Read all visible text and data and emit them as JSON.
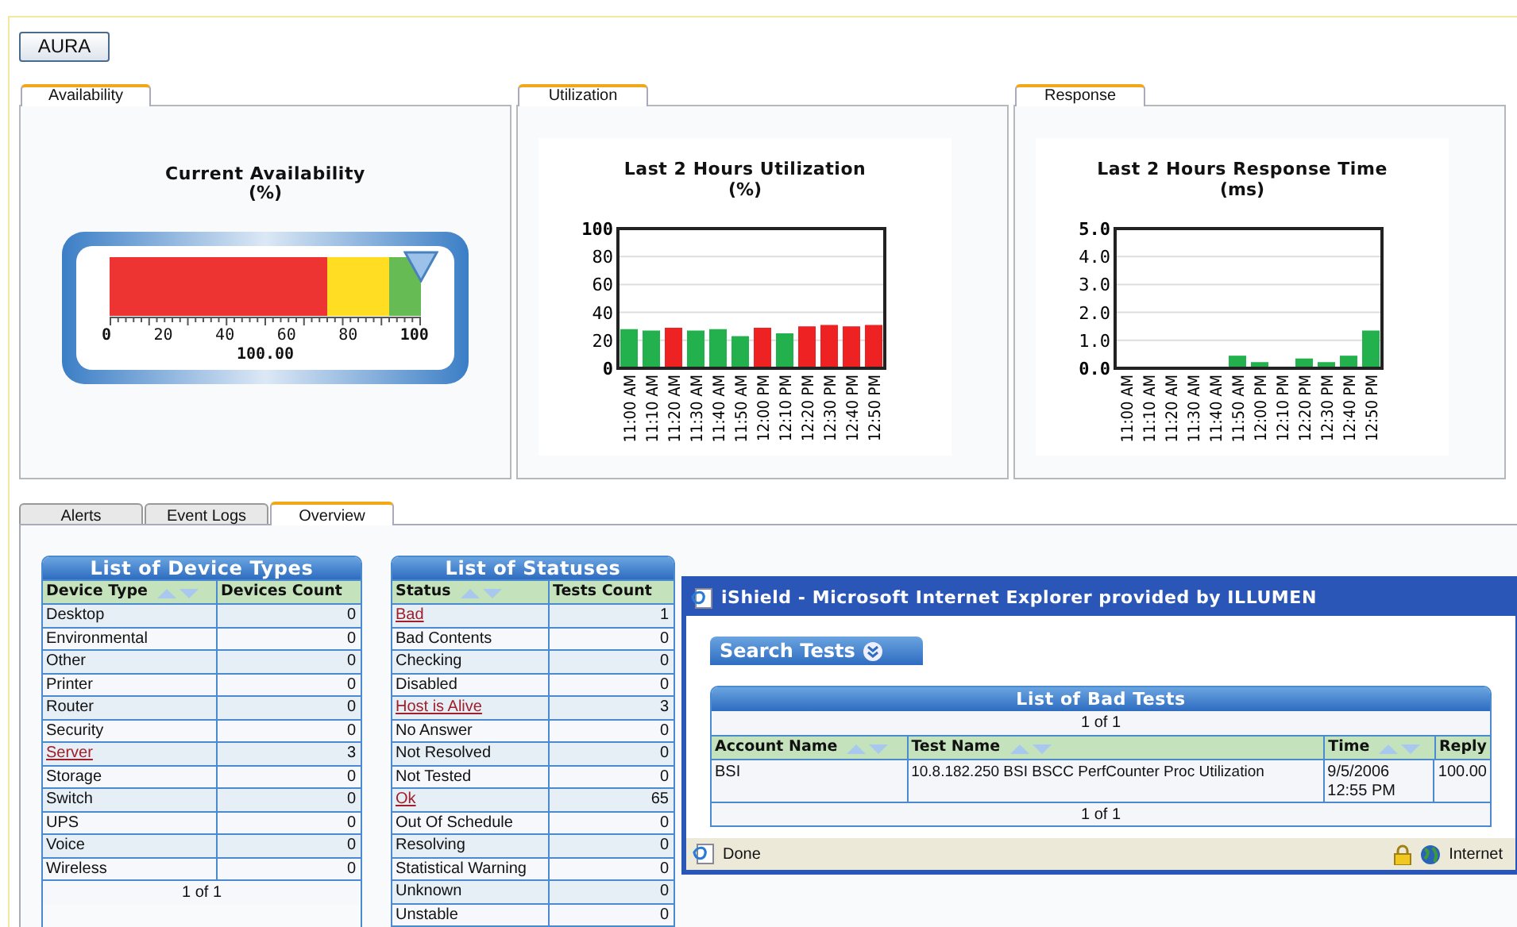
{
  "account_button": "AURA",
  "panels": [
    {
      "tab": "Availability",
      "kind": "gauge",
      "title": "Current Availability",
      "unit": "(%)",
      "reading": "100.00",
      "scale": [
        "0",
        "20",
        "40",
        "60",
        "80",
        "100"
      ],
      "bands": [
        {
          "color": "#ee3333"
        },
        {
          "color": "#ffdd22"
        },
        {
          "color": "#66bb55"
        }
      ]
    },
    {
      "tab": "Utilization",
      "kind": "chart",
      "chart_data": {
        "type": "bar",
        "title": "Last 2 Hours Utilization",
        "ylabel": "(%)",
        "stacked": true,
        "categories": [
          "11:00 AM",
          "11:10 AM",
          "11:20 AM",
          "11:30 AM",
          "11:40 AM",
          "11:50 AM",
          "12:00 PM",
          "12:10 PM",
          "12:20 PM",
          "12:30 PM",
          "12:40 PM",
          "12:50 PM"
        ],
        "series": [
          {
            "color": "#22b14c",
            "values": [
              28,
              27,
              null,
              27,
              28,
              23,
              null,
              25,
              null,
              null,
              null,
              null
            ]
          },
          {
            "color": "#ee2222",
            "values": [
              null,
              null,
              29,
              null,
              null,
              null,
              29,
              null,
              30,
              31,
              30,
              31
            ]
          }
        ],
        "ylim": [
          0,
          100
        ],
        "yticks": [
          0,
          20,
          40,
          60,
          80,
          100
        ],
        "grid": true
      }
    },
    {
      "tab": "Response",
      "kind": "chart",
      "chart_data": {
        "type": "bar",
        "title": "Last 2 Hours Response Time",
        "ylabel": "(ms)",
        "stacked": true,
        "categories": [
          "11:00 AM",
          "11:10 AM",
          "11:20 AM",
          "11:30 AM",
          "11:40 AM",
          "11:50 AM",
          "12:00 PM",
          "12:10 PM",
          "12:20 PM",
          "12:30 PM",
          "12:40 PM",
          "12:50 PM"
        ],
        "series": [
          {
            "color": "#22b14c",
            "values": [
              0,
              0,
              0,
              0,
              0,
              0.45,
              0.22,
              0,
              0.35,
              0.22,
              0.45,
              1.35
            ]
          }
        ],
        "grid": true,
        "ylim": [
          0,
          5
        ],
        "yticks": [
          {
            "value": 0,
            "label": "0.0"
          },
          {
            "value": 1,
            "label": "1.0"
          },
          {
            "value": 2,
            "label": "2.0"
          },
          {
            "value": 3,
            "label": "3.0"
          },
          {
            "value": 4,
            "label": "4.0"
          },
          {
            "value": 5,
            "label": "5.0"
          }
        ]
      }
    }
  ],
  "bottom_tabs": [
    {
      "label": "Alerts",
      "selected": false
    },
    {
      "label": "Event Logs",
      "selected": false
    },
    {
      "label": "Overview",
      "selected": true
    }
  ],
  "device_types": {
    "title": "List of Device Types",
    "columns": [
      "Device Type",
      "Devices Count"
    ],
    "rows": [
      {
        "name": "Desktop",
        "count": "0",
        "link": false
      },
      {
        "name": "Environmental",
        "count": "0",
        "link": false
      },
      {
        "name": "Other",
        "count": "0",
        "link": false
      },
      {
        "name": "Printer",
        "count": "0",
        "link": false
      },
      {
        "name": "Router",
        "count": "0",
        "link": false
      },
      {
        "name": "Security",
        "count": "0",
        "link": false
      },
      {
        "name": "Server",
        "count": "3",
        "link": true
      },
      {
        "name": "Storage",
        "count": "0",
        "link": false
      },
      {
        "name": "Switch",
        "count": "0",
        "link": false
      },
      {
        "name": "UPS",
        "count": "0",
        "link": false
      },
      {
        "name": "Voice",
        "count": "0",
        "link": false
      },
      {
        "name": "Wireless",
        "count": "0",
        "link": false
      }
    ],
    "pager": "1 of 1"
  },
  "statuses": {
    "title": "List of Statuses",
    "columns": [
      "Status",
      "Tests Count"
    ],
    "rows": [
      {
        "name": "Bad",
        "count": "1",
        "link": true
      },
      {
        "name": "Bad Contents",
        "count": "0",
        "link": false
      },
      {
        "name": "Checking",
        "count": "0",
        "link": false
      },
      {
        "name": "Disabled",
        "count": "0",
        "link": false
      },
      {
        "name": "Host is Alive",
        "count": "3",
        "link": true
      },
      {
        "name": "No Answer",
        "count": "0",
        "link": false
      },
      {
        "name": "Not Resolved",
        "count": "0",
        "link": false
      },
      {
        "name": "Not Tested",
        "count": "0",
        "link": false
      },
      {
        "name": "Ok",
        "count": "65",
        "link": true
      },
      {
        "name": "Out Of Schedule",
        "count": "0",
        "link": false
      },
      {
        "name": "Resolving",
        "count": "0",
        "link": false
      },
      {
        "name": "Statistical Warning",
        "count": "0",
        "link": false
      },
      {
        "name": "Unknown",
        "count": "0",
        "link": false
      },
      {
        "name": "Unstable",
        "count": "0",
        "link": false
      }
    ]
  },
  "popup": {
    "title": "iShield - Microsoft Internet Explorer provided by ILLUMEN",
    "search_button": "Search Tests",
    "table": {
      "title": "List of Bad Tests",
      "pager_top": "1 of 1",
      "columns": [
        "Account Name",
        "Test Name",
        "Time",
        "Reply"
      ],
      "rows": [
        {
          "account": "BSI",
          "test": "10.8.182.250 BSI BSCC PerfCounter Proc Utilization",
          "time": "9/5/2006 12:55 PM",
          "reply": "100.00"
        }
      ],
      "pager_bottom": "1 of 1"
    },
    "status_text": "Done",
    "zone": "Internet"
  }
}
